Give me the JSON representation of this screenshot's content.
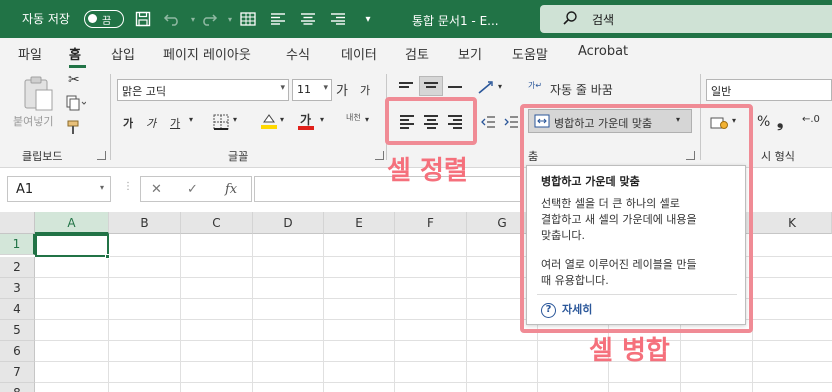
{
  "titlebar": {
    "autosave_label": "자동 저장",
    "autosave_toggle": "끔",
    "doc_title": "통합 문서1  -  E...",
    "search_placeholder": "검색",
    "accent_color": "#217346"
  },
  "tabs": [
    "파일",
    "홈",
    "삽입",
    "페이지 레이아웃",
    "수식",
    "데이터",
    "검토",
    "보기",
    "도움말",
    "Acrobat"
  ],
  "active_tab": "홈",
  "ribbon": {
    "clipboard": {
      "paste_label": "붙여넣기",
      "group_label": "클립보드"
    },
    "font": {
      "font_name": "맑은 고딕",
      "font_size": "11",
      "grow_label": "가",
      "shrink_label": "가",
      "bold_label": "가",
      "italic_label": "가",
      "underline_label": "가",
      "font_color_label": "가",
      "phonetic_label": "내천",
      "group_label": "글꼴"
    },
    "alignment": {
      "wrap_text_label": "자동 줄 바꿈",
      "merge_center_label": "병합하고 가운데 맞춤",
      "group_label_partial": "춤"
    },
    "number": {
      "format_value": "일반",
      "group_label_partial": "시 형식"
    }
  },
  "formula_bar": {
    "name_box": "A1",
    "cancel_symbol": "✕",
    "enter_symbol": "✓",
    "fx_symbol": "fx",
    "formula_value": ""
  },
  "grid": {
    "columns": [
      "A",
      "B",
      "C",
      "D",
      "E",
      "F",
      "G",
      "H",
      "I",
      "J",
      "K"
    ],
    "rows": [
      "1",
      "2",
      "3",
      "4",
      "5",
      "6",
      "7",
      "8"
    ],
    "active_cell": "A1"
  },
  "tooltip": {
    "title": "병합하고 가운데 맞춤",
    "desc_line1": "선택한 셀을 더 큰 하나의 셀로",
    "desc_line2": "결합하고 새 셀의 가운데에 내용을",
    "desc_line3": "맞춥니다.",
    "use_line1": "여러 열로 이루어진 레이블을 만들",
    "use_line2": "때 유용합니다.",
    "help_label": "자세히"
  },
  "annotations": {
    "cell_align": "셀 정렬",
    "cell_merge": "셀 병합",
    "highlight_color": "#f08b95"
  }
}
